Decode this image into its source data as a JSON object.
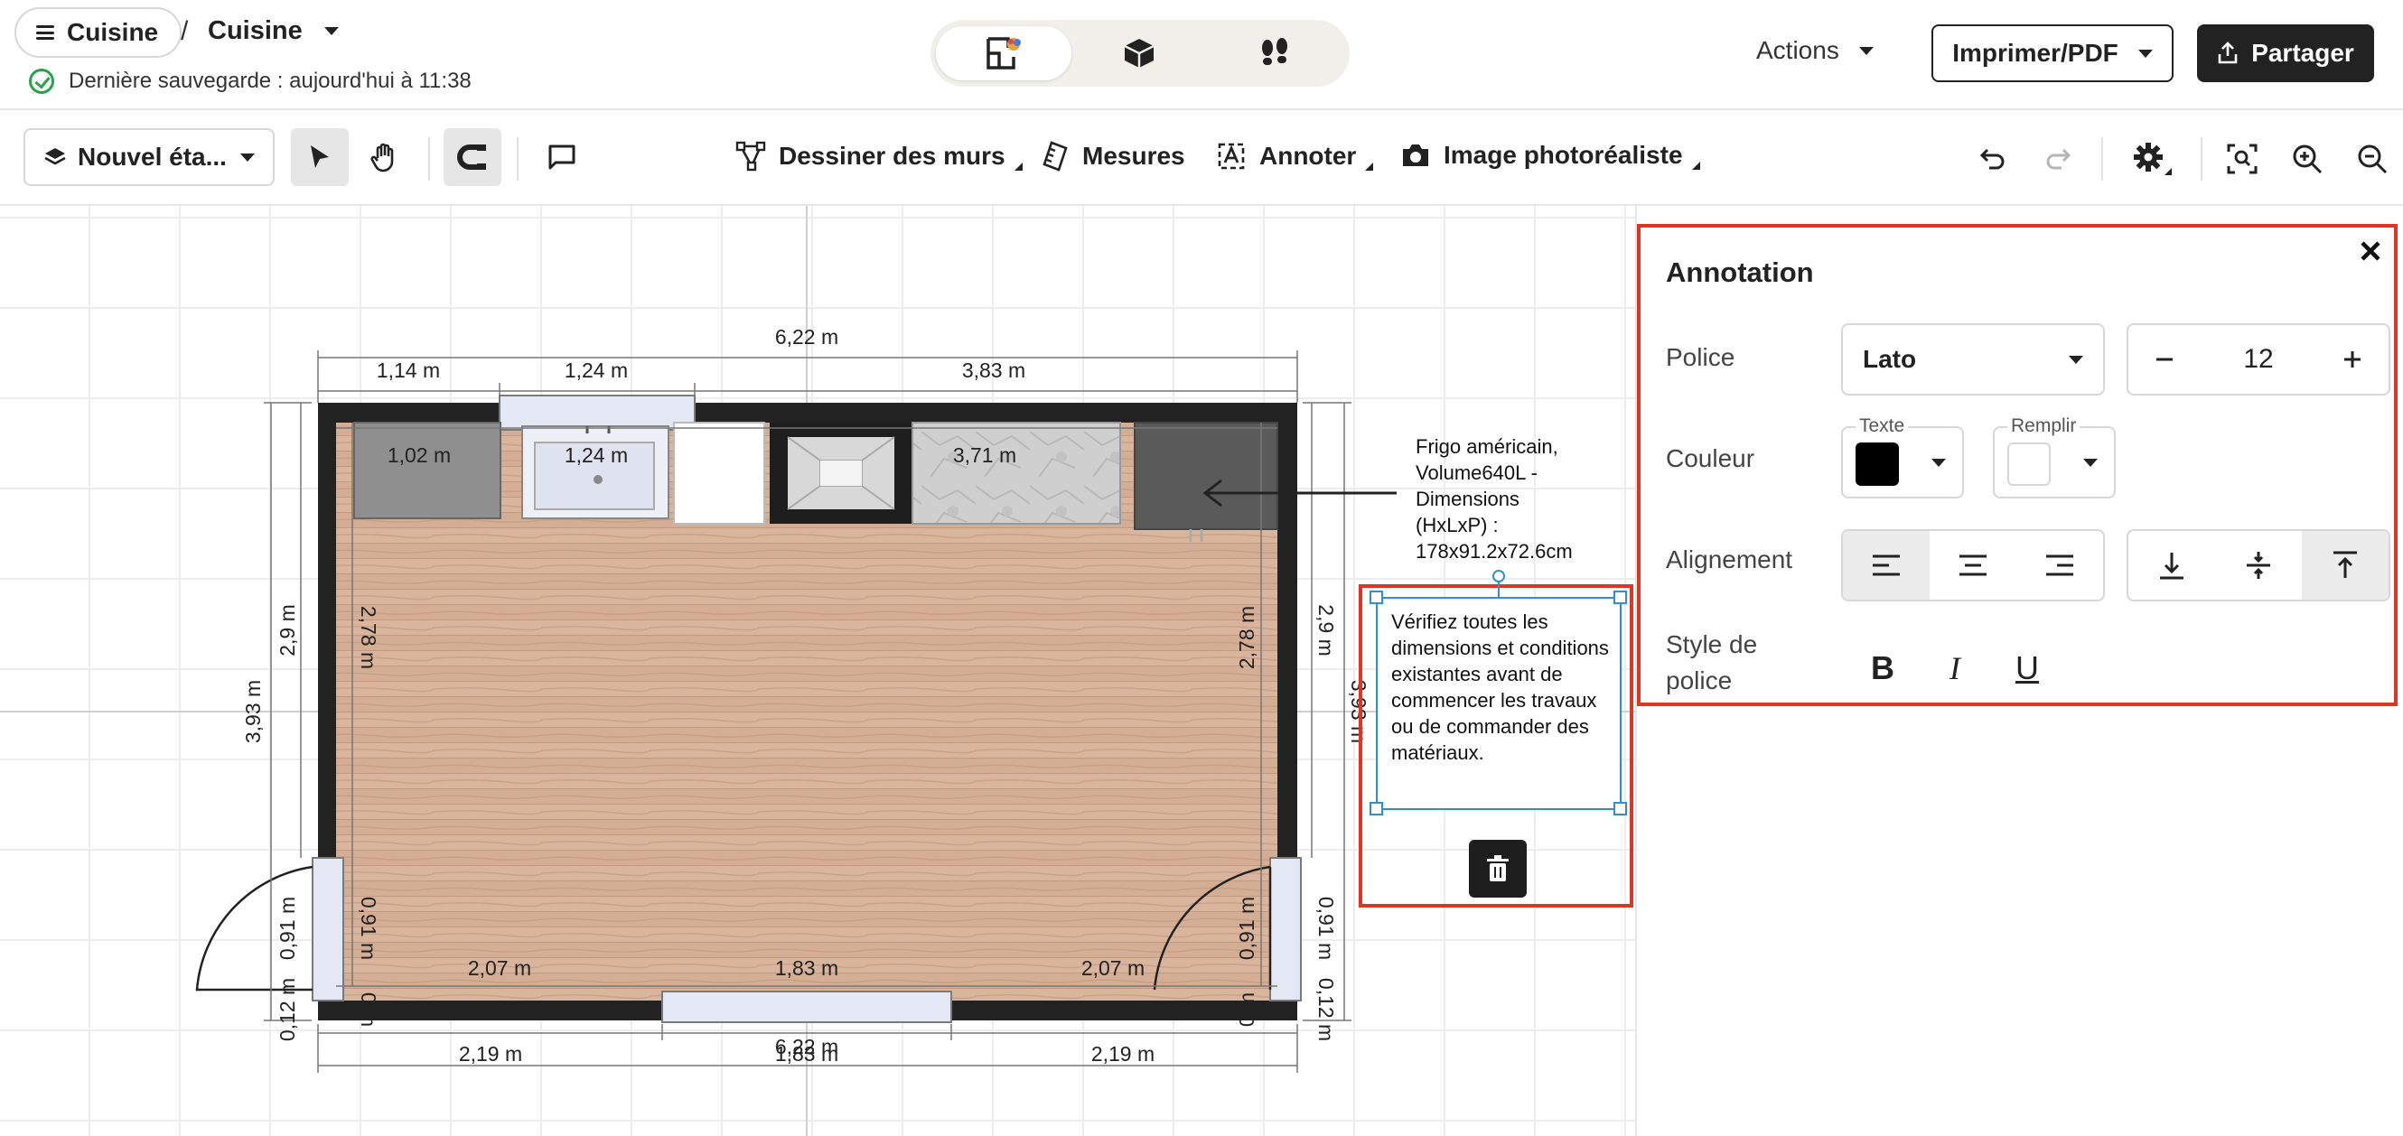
{
  "header": {
    "menu_label": "Cuisine",
    "breadcrumb_separator": "/",
    "project_name": "Cuisine",
    "save_status": "Dernière sauvegarde : aujourd'hui à 11:38",
    "views": [
      "2d-plan-icon",
      "3d-box-icon",
      "footsteps-icon"
    ],
    "actions_label": "Actions",
    "print_label": "Imprimer/PDF",
    "share_label": "Partager"
  },
  "toolbar": {
    "level_label": "Nouvel éta...",
    "draw_walls": "Dessiner des murs",
    "measures": "Mesures",
    "annotate": "Annoter",
    "photo": "Image photoréaliste"
  },
  "plan": {
    "dims": {
      "top_total": "6,22 m",
      "top_seg1": "1,14 m",
      "top_seg2": "1,24 m",
      "top_seg3": "3,83 m",
      "inner_1": "1,02 m",
      "inner_2": "1,24 m",
      "inner_3": "3,71 m",
      "left_outer": "3,93 m",
      "left_mid": "2,9 m",
      "left_inner": "2,78 m",
      "right_inner": "2,78 m",
      "right_mid": "2,9 m",
      "right_outer": "3,93 m",
      "left_door_outer": "0,91 m",
      "left_door_inner": "0,91 m",
      "right_door_inner": "0,91 m",
      "right_door_outer": "0,91 m",
      "left_bottom_outer": "0,12 m",
      "left_bottom_inner": "0 m",
      "right_bottom_inner": "0 m",
      "right_bottom_outer": "0,12 m",
      "bottom_inner_1": "2,07 m",
      "bottom_inner_2": "1,83 m",
      "bottom_inner_3": "2,07 m",
      "bottom_outer_1": "2,19 m",
      "bottom_outer_2": "1,83 m",
      "bottom_outer_2_overlap": "6,22 m",
      "bottom_outer_3": "2,19 m"
    },
    "fridge_note": [
      "Frigo américain,",
      "Volume640L  -",
      "Dimensions",
      "(HxLxP) :",
      "178x91.2x72.6cm"
    ],
    "warning_note": "Vérifiez toutes les dimensions et conditions existantes avant de commencer les travaux ou de commander des matériaux."
  },
  "annotation_panel": {
    "title": "Annotation",
    "font_label": "Police",
    "font_value": "Lato",
    "size_value": "12",
    "color_label": "Couleur",
    "text_tag": "Texte",
    "fill_tag": "Remplir",
    "text_color": "#000000",
    "fill_color": "#ffffff",
    "align_label": "Alignement",
    "style_label": "Style de police",
    "bold": "B",
    "italic": "I",
    "underline": "U"
  }
}
